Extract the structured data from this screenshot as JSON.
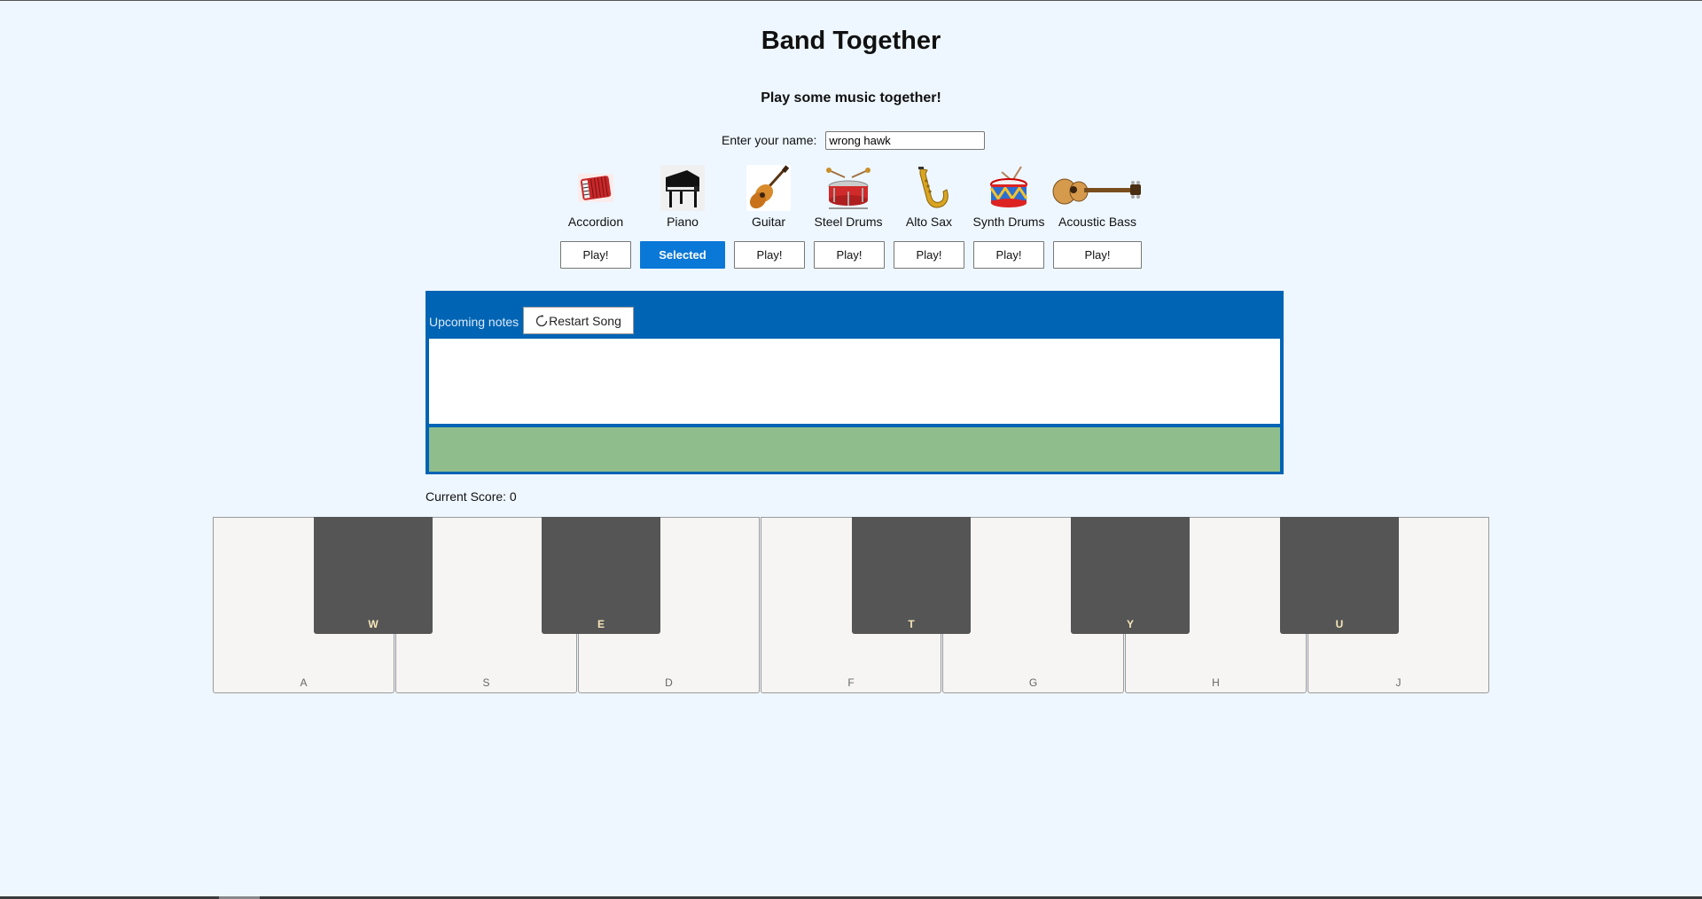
{
  "app": {
    "title": "Band Together",
    "subtitle": "Play some music together!"
  },
  "name_field": {
    "label": "Enter your name:",
    "value": "wrong hawk"
  },
  "instruments": [
    {
      "label": "Accordion",
      "icon": "accordion-icon",
      "button": "Play!"
    },
    {
      "label": "Piano",
      "icon": "piano-icon",
      "button": "Selected"
    },
    {
      "label": "Guitar",
      "icon": "guitar-icon",
      "button": "Play!"
    },
    {
      "label": "Steel Drums",
      "icon": "steel-drum-icon",
      "button": "Play!"
    },
    {
      "label": "Alto Sax",
      "icon": "saxophone-icon",
      "button": "Play!"
    },
    {
      "label": "Synth Drums",
      "icon": "drum-icon",
      "button": "Play!"
    },
    {
      "label": "Acoustic Bass",
      "icon": "acoustic-bass-icon",
      "button": "Play!"
    }
  ],
  "notes_panel": {
    "label": "Upcoming notes",
    "restart_label": "Restart Song"
  },
  "score": {
    "text": "Current Score: 0"
  },
  "keyboard": {
    "white_keys": [
      "A",
      "S",
      "D",
      "F",
      "G",
      "H",
      "J"
    ],
    "black_keys": [
      "W",
      "E",
      "T",
      "Y",
      "U"
    ]
  },
  "colors": {
    "background": "#eef7ff",
    "accent": "#0a78d7",
    "panel": "#0064b4",
    "hit_zone": "#8fbd8c"
  }
}
